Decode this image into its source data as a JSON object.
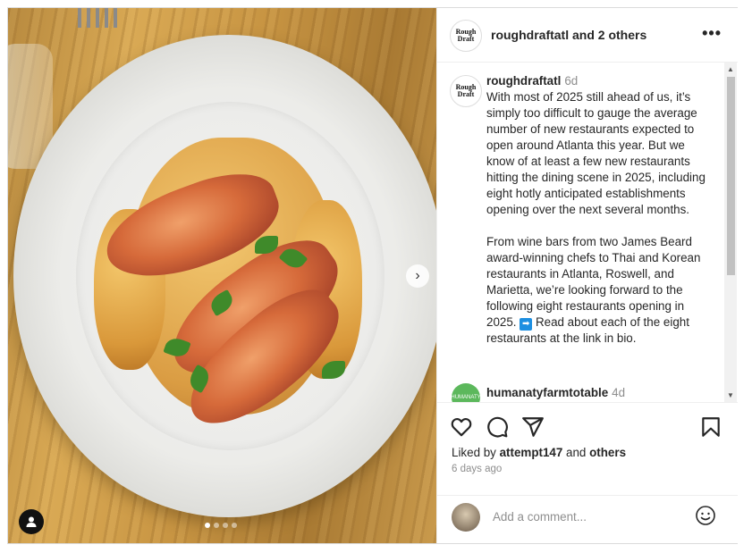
{
  "header": {
    "logo_text_top": "Rough",
    "logo_text_bottom": "Draft",
    "username": "roughdraftatl",
    "collab_text": " and 2 others",
    "more_label": "•••"
  },
  "caption": {
    "username": "roughdraftatl",
    "time": "6d",
    "paragraph1": "With most of 2025 still ahead of us, it’s simply too difficult to gauge the average number of new restaurants expected to open around Atlanta this year. But we know of at least a few new restaurants hitting the dining scene in 2025, including eight hotly anticipated establishments opening over the next several months.",
    "paragraph2_start": "From wine bars from two James Beard award-winning chefs to Thai and Korean restaurants in Atlanta, Roswell, and Marietta, we’re looking forward to the following eight restaurants opening in 2025. ",
    "arrow_emoji": "➡",
    "paragraph2_end": " Read about each of the eight restaurants at the link in bio."
  },
  "comment2": {
    "username": "humanatyfarmtotable",
    "time": "4d",
    "avatar_text": "HUMANATY"
  },
  "actions": {
    "like_icon": "heart-icon",
    "comment_icon": "comment-icon",
    "share_icon": "share-icon",
    "save_icon": "bookmark-icon"
  },
  "likes": {
    "prefix": "Liked by ",
    "user": "attempt147",
    "middle": " and ",
    "others": "others"
  },
  "date": "6 days ago",
  "comment_box": {
    "placeholder": "Add a comment..."
  },
  "carousel": {
    "next_label": "›",
    "total_slides": 4,
    "active_slide": 1
  },
  "colors": {
    "text": "#262626",
    "muted": "#8e8e8e",
    "border": "#dbdbdb"
  }
}
